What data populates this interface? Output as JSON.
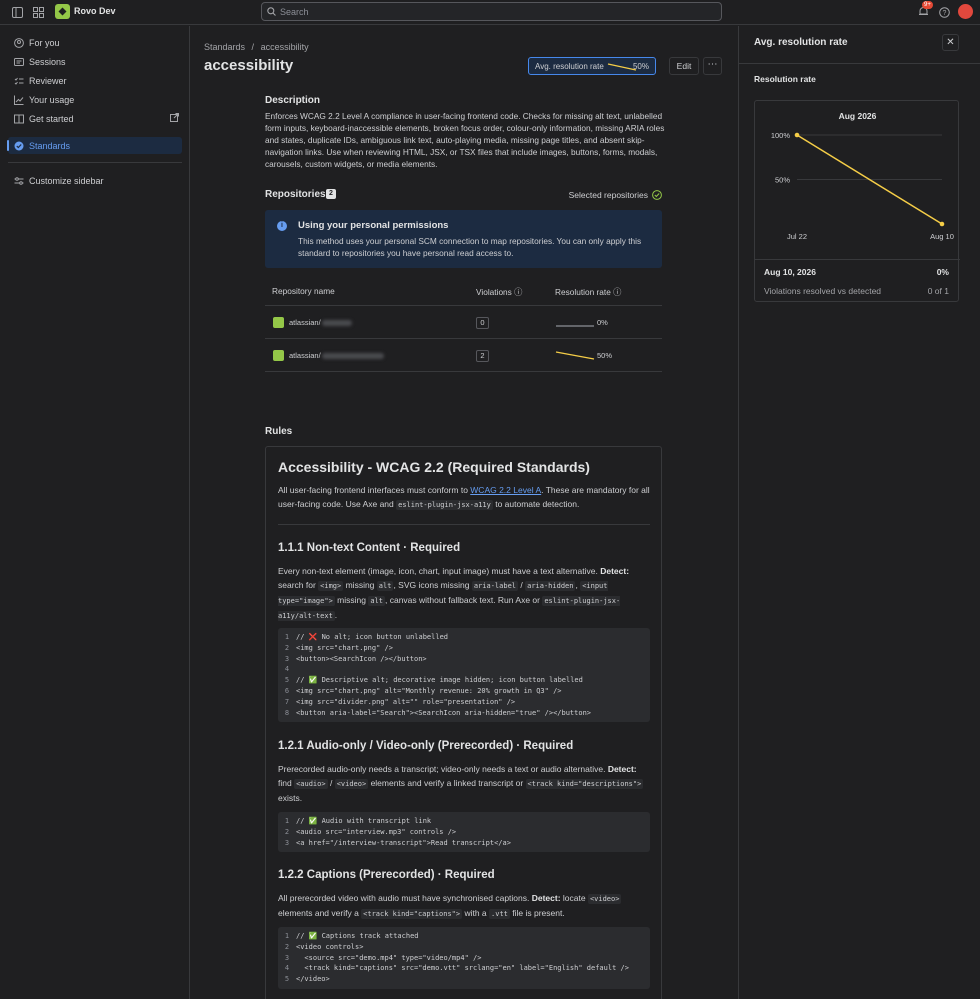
{
  "topbar": {
    "app_name": "Rovo Dev",
    "search_placeholder": "Search",
    "notifications_badge": "9+"
  },
  "sidebar": {
    "items": [
      {
        "label": "For you",
        "icon": "user-circle-icon"
      },
      {
        "label": "Sessions",
        "icon": "sessions-icon"
      },
      {
        "label": "Reviewer",
        "icon": "reviewer-icon"
      },
      {
        "label": "Your usage",
        "icon": "chart-line-icon"
      },
      {
        "label": "Get started",
        "icon": "book-icon"
      },
      {
        "label": "Standards",
        "icon": "check-circle-icon"
      },
      {
        "label": "Customize sidebar",
        "icon": "sliders-icon"
      }
    ]
  },
  "main": {
    "breadcrumb": {
      "root": "Standards",
      "sep": "/",
      "current": "accessibility"
    },
    "title": "accessibility",
    "rate_button": {
      "label": "Avg. resolution rate",
      "value": "50%"
    },
    "edit_label": "Edit",
    "more_label": "⋯",
    "description_heading": "Description",
    "description": "Enforces WCAG 2.2 Level A compliance in user-facing frontend code. Checks for missing alt text, unlabelled form inputs, keyboard-inaccessible elements, broken focus order, colour-only information, missing ARIA roles and states, duplicate IDs, ambiguous link text, auto-playing media, missing page titles, and absent skip-navigation links. Use when reviewing HTML, JSX, or TSX files that include images, buttons, forms, modals, carousels, custom widgets, or media elements.",
    "repositories_heading": "Repositories",
    "repositories_count": "2",
    "selected_repositories": "Selected repositories",
    "info": {
      "title": "Using your personal permissions",
      "text": "This method uses your personal SCM connection to map repositories. You can only apply this standard to repositories you have personal read access to."
    },
    "table": {
      "headers": {
        "name": "Repository name",
        "violations": "Violations",
        "rate": "Resolution rate"
      },
      "rows": [
        {
          "name": "atlassian/",
          "violations": "0",
          "rate": "0%",
          "rate_value": 0
        },
        {
          "name": "atlassian/",
          "violations": "2",
          "rate": "50%",
          "rate_value": 50
        }
      ]
    },
    "rules_heading": "Rules",
    "rules": {
      "h1": "Accessibility - WCAG 2.2 (Required Standards)",
      "intro_pre": "All user-facing frontend interfaces must conform to ",
      "intro_link": "WCAG 2.2 Level A",
      "intro_mid": ". These are mandatory for all user-facing code. Use Axe and ",
      "intro_code": "eslint-plugin-jsx-a11y",
      "intro_post": " to automate detection.",
      "s1_title": "1.1.1 Non-text Content · Required",
      "s1_p1": "Every non-text element (image, icon, chart, input image) must have a text alternative. ",
      "s1_detect": "Detect:",
      "s1_p2": " search for ",
      "s1_c1": "<img>",
      "s1_p3": " missing ",
      "s1_c2": "alt",
      "s1_p4": ", SVG icons missing ",
      "s1_c3": "aria-label",
      "s1_p5": " / ",
      "s1_c4": "aria-hidden",
      "s1_p6": ", ",
      "s1_c5": "<input type=\"image\">",
      "s1_p7": " missing ",
      "s1_c6": "alt",
      "s1_p8": ", canvas without fallback text. Run Axe or ",
      "s1_c7": "eslint-plugin-jsx-a11y/alt-text",
      "s1_p9": ".",
      "s1_code": [
        "// ❌ No alt; icon button unlabelled",
        "<img src=\"chart.png\" />",
        "<button><SearchIcon /></button>",
        "",
        "// ✅ Descriptive alt; decorative image hidden; icon button labelled",
        "<img src=\"chart.png\" alt=\"Monthly revenue: 20% growth in Q3\" />",
        "<img src=\"divider.png\" alt=\"\" role=\"presentation\" />",
        "<button aria-label=\"Search\"><SearchIcon aria-hidden=\"true\" /></button>"
      ],
      "s2_title": "1.2.1 Audio-only / Video-only (Prerecorded) · Required",
      "s2_p1": "Prerecorded audio-only needs a transcript; video-only needs a text or audio alternative. ",
      "s2_detect": "Detect:",
      "s2_p2": " find ",
      "s2_c1": "<audio>",
      "s2_p3": " / ",
      "s2_c2": "<video>",
      "s2_p4": " elements and verify a linked transcript or ",
      "s2_c3": "<track kind=\"descriptions\">",
      "s2_p5": " exists.",
      "s2_code": [
        "// ✅ Audio with transcript link",
        "<audio src=\"interview.mp3\" controls />",
        "<a href=\"/interview-transcript\">Read transcript</a>"
      ],
      "s3_title": "1.2.2 Captions (Prerecorded) · Required",
      "s3_p1": "All prerecorded video with audio must have synchronised captions. ",
      "s3_detect": "Detect:",
      "s3_p2": " locate ",
      "s3_c1": "<video>",
      "s3_p3": " elements and verify a ",
      "s3_c2": "<track kind=\"captions\">",
      "s3_p4": " with a ",
      "s3_c3": ".vtt",
      "s3_p5": " file is present.",
      "s3_code": [
        "// ✅ Captions track attached",
        "<video controls>",
        "  <source src=\"demo.mp4\" type=\"video/mp4\" />",
        "  <track kind=\"captions\" src=\"demo.vtt\" srclang=\"en\" label=\"English\" default />",
        "</video>"
      ]
    }
  },
  "panel": {
    "title": "Avg. resolution rate",
    "close_label": "✕",
    "subtitle": "Resolution rate",
    "chart_summary": {
      "date": "Aug 10, 2026",
      "percent": "0%",
      "label": "Violations resolved vs detected",
      "fraction": "0 of 1"
    }
  },
  "chart_data": {
    "type": "line",
    "title": "Aug 2026",
    "x": [
      "Jul 22",
      "Aug 10"
    ],
    "series": [
      {
        "values": [
          100,
          0
        ]
      }
    ],
    "yticks": [
      "100%",
      "50%"
    ],
    "ylim": [
      0,
      100
    ],
    "grid": true,
    "color": "#f5cd47"
  },
  "colors": {
    "accent": "#669df1",
    "brand": "#94c748",
    "line": "#f5cd47"
  }
}
